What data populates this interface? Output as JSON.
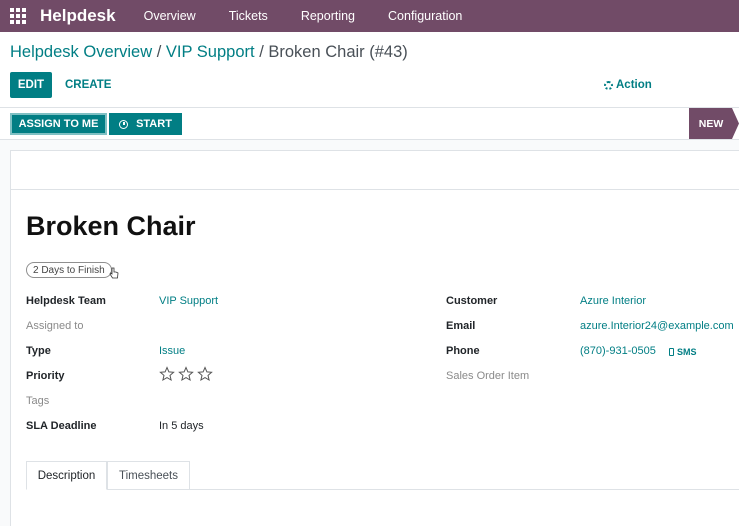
{
  "navbar": {
    "brand": "Helpdesk",
    "items": [
      "Overview",
      "Tickets",
      "Reporting",
      "Configuration"
    ]
  },
  "breadcrumb": {
    "items": [
      "Helpdesk Overview",
      "VIP Support"
    ],
    "separator": "/",
    "current": "Broken Chair (#43)"
  },
  "controls": {
    "edit_label": "EDIT",
    "create_label": "CREATE",
    "action_label": "Action"
  },
  "statusbar": {
    "assign_label": "ASSIGN TO ME",
    "start_label": "START",
    "stage": "NEW"
  },
  "ticket": {
    "title": "Broken Chair",
    "days_badge": "2 Days to Finish",
    "left_fields": [
      {
        "label": "Helpdesk Team",
        "value": "VIP Support"
      },
      {
        "label": "Assigned to",
        "value": ""
      },
      {
        "label": "Type",
        "value": "Issue"
      },
      {
        "label": "Priority",
        "value": ""
      },
      {
        "label": "Tags",
        "value": ""
      },
      {
        "label": "SLA Deadline",
        "value": "In 5 days"
      }
    ],
    "priority_stars": {
      "filled": 0,
      "total": 3
    },
    "right_fields": [
      {
        "label": "Customer",
        "value": "Azure Interior"
      },
      {
        "label": "Email",
        "value": "azure.Interior24@example.com"
      },
      {
        "label": "Phone",
        "value": "(870)-931-0505"
      },
      {
        "label": "Sales Order Item",
        "value": ""
      }
    ],
    "sms_label": "SMS"
  },
  "tabs": [
    {
      "label": "Description",
      "active": true
    },
    {
      "label": "Timesheets",
      "active": false
    }
  ],
  "colors": {
    "brand": "#714b67",
    "accent": "#017e84"
  }
}
